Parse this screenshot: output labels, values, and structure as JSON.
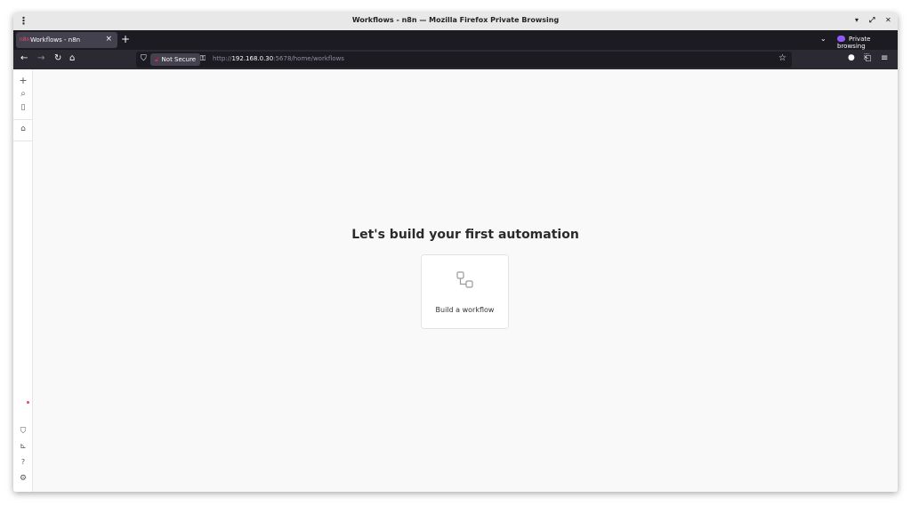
{
  "titlebar": {
    "menu_icon": "⋮",
    "title": "Workflows - n8n — Mozilla Firefox Private Browsing",
    "minimize": "▾",
    "maximize": "⤢",
    "close": "✕"
  },
  "tabs": {
    "active": {
      "favicon": "n8n",
      "label": "Workflows - n8n",
      "close": "×"
    },
    "new_tab": "+",
    "list_tabs": "⌄",
    "private_label": "Private browsing"
  },
  "navbar": {
    "back": "←",
    "forward": "→",
    "reload": "↻",
    "home": "⌂",
    "not_secure": "Not Secure",
    "url_scheme": "http://",
    "url_host": "192.168.0.30",
    "url_rest": ":5678/home/workflows",
    "bookmark": "☆",
    "account": "●",
    "extensions": "⎗",
    "menu": "≡"
  },
  "sidebar": {
    "add": "+",
    "search": "⌕",
    "panel": "▯",
    "home": "⌂",
    "templates": "⛉",
    "insights": "⊾",
    "help": "?",
    "settings": "⚙"
  },
  "main": {
    "heading": "Let's build your first automation",
    "card_label": "Build a workflow"
  },
  "colors": {
    "n8n_accent": "#ea4b71",
    "private_purple": "#9059ff",
    "insecure_red": "#e22850"
  }
}
